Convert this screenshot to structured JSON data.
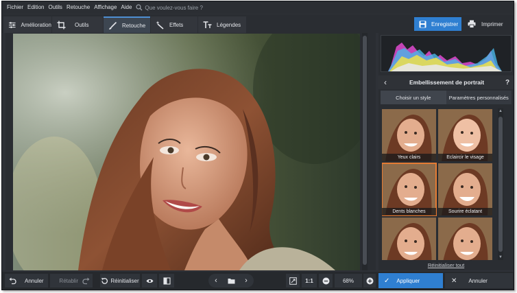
{
  "menu": {
    "items": [
      "Fichier",
      "Edition",
      "Outils",
      "Retouche",
      "Affichage",
      "Aide"
    ],
    "search_placeholder": "Que voulez-vous faire ?"
  },
  "toolbar": {
    "tabs": [
      {
        "label": "Amélioration",
        "icon": "sliders-icon"
      },
      {
        "label": "Outils",
        "icon": "crop-icon"
      },
      {
        "label": "Retouche",
        "icon": "brush-icon",
        "active": true
      },
      {
        "label": "Effets",
        "icon": "magic-wand-icon"
      },
      {
        "label": "Légendes",
        "icon": "text-icon"
      }
    ],
    "save_label": "Enregistrer",
    "print_label": "Imprimer"
  },
  "panel": {
    "title": "Embellissement de portrait",
    "help": "?",
    "tabs": [
      "Choisir un style",
      "Paramètres personnalisés"
    ],
    "active_tab": 0,
    "styles": [
      "Yeux clairs",
      "Eclaircir le visage",
      "Dents blanches",
      "Sourire éclatant",
      "",
      ""
    ],
    "selected_style": 2,
    "reset_all": "Réinitialiser tout"
  },
  "bottom": {
    "undo": "Annuler",
    "redo": "Rétablir",
    "reset": "Réinitialiser",
    "actual_size": "1:1",
    "zoom": "68%",
    "apply": "Appliquer",
    "cancel": "Annuler"
  },
  "colors": {
    "accent": "#2f7fd1",
    "selection": "#e57b33",
    "background": "#2e3137"
  }
}
